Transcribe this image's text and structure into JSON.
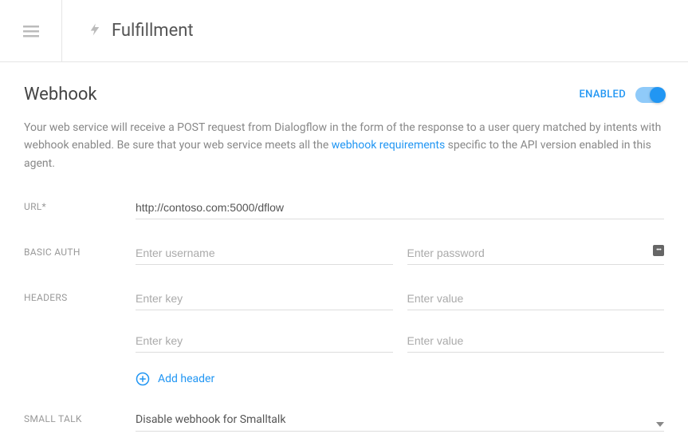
{
  "header": {
    "title": "Fulfillment"
  },
  "webhook": {
    "section_title": "Webhook",
    "enabled_label": "ENABLED",
    "enabled": true,
    "description_pre": "Your web service will receive a POST request from Dialogflow in the form of the response to a user query matched by intents with webhook enabled. Be sure that your web service meets all the ",
    "description_link": "webhook requirements",
    "description_post": " specific to the API version enabled in this agent."
  },
  "form": {
    "url": {
      "label": "URL*",
      "value": "http://contoso.com:5000/dflow"
    },
    "basic_auth": {
      "label": "BASIC AUTH",
      "username_placeholder": "Enter username",
      "username_value": "",
      "password_placeholder": "Enter password",
      "password_value": ""
    },
    "headers": {
      "label": "HEADERS",
      "rows": [
        {
          "key_placeholder": "Enter key",
          "key_value": "",
          "value_placeholder": "Enter value",
          "value_value": ""
        },
        {
          "key_placeholder": "Enter key",
          "key_value": "",
          "value_placeholder": "Enter value",
          "value_value": ""
        }
      ],
      "add_label": "Add header"
    },
    "small_talk": {
      "label": "SMALL TALK",
      "selected": "Disable webhook for Smalltalk"
    }
  }
}
